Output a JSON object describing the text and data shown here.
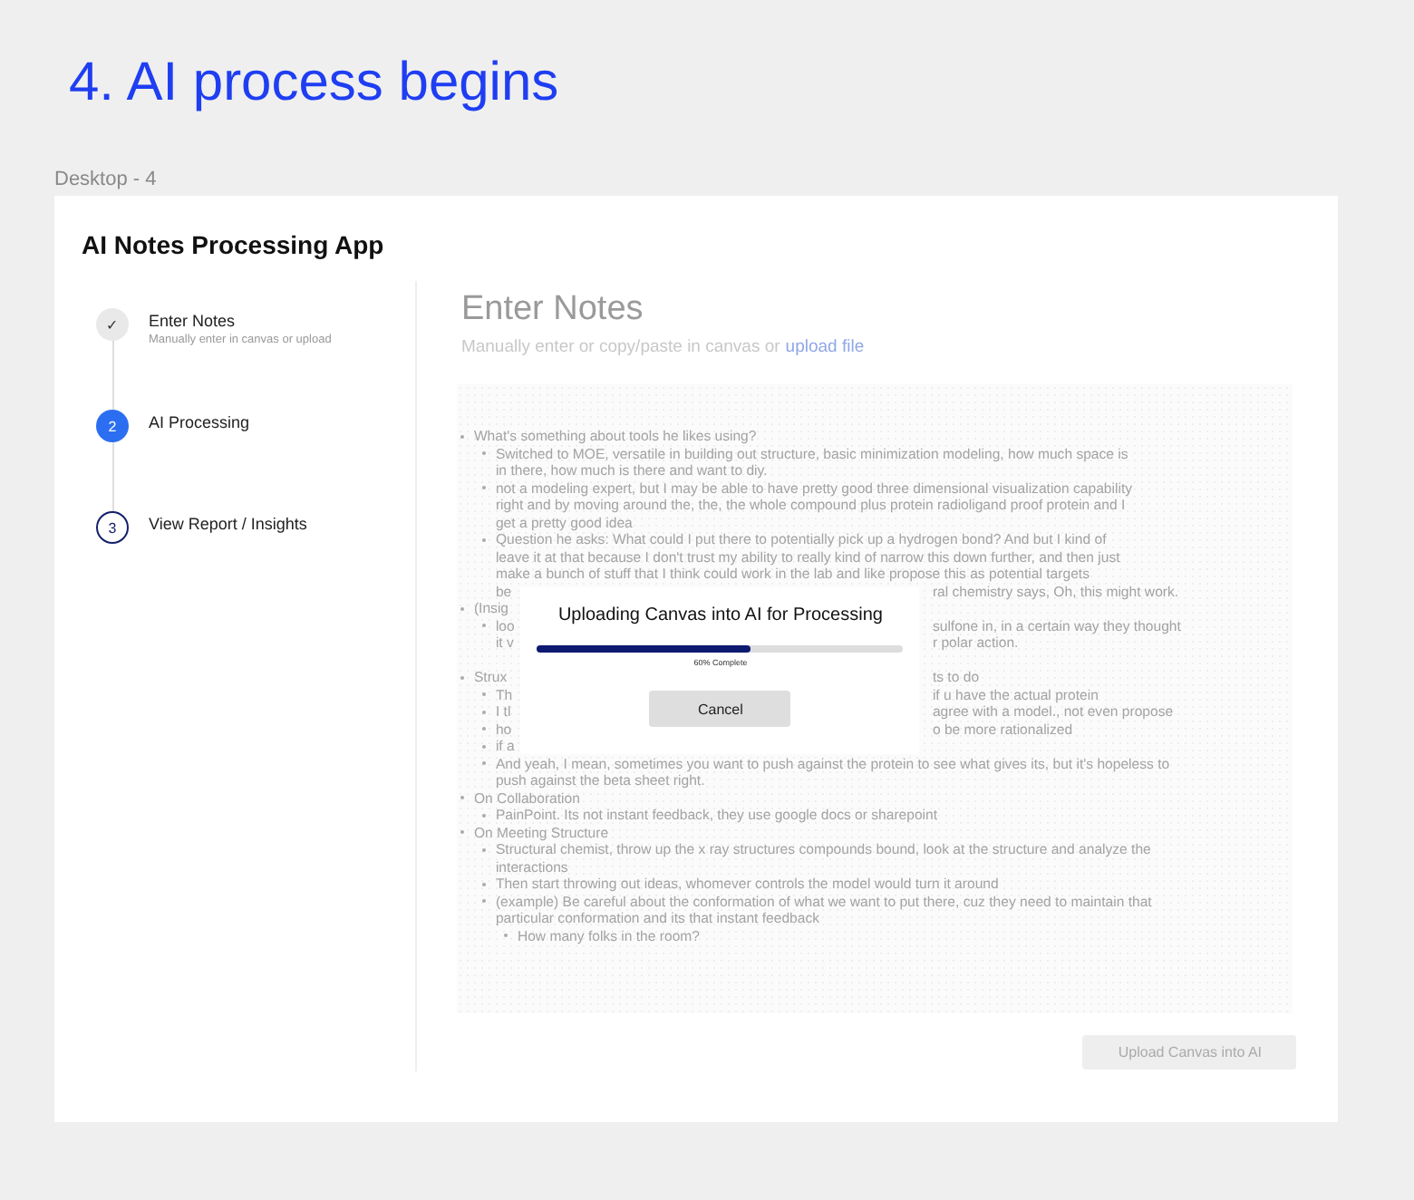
{
  "page_title": "4. AI process begins",
  "frame_label": "Desktop - 4",
  "app_title": "AI Notes Processing App",
  "steps": [
    {
      "marker": "✓",
      "label": "Enter Notes",
      "hint": "Manually enter in canvas or upload",
      "completed": true,
      "selected": false
    },
    {
      "marker": "2",
      "label": "AI Processing",
      "completed": false,
      "selected": true
    },
    {
      "marker": "3",
      "label": "View Report / Insights",
      "completed": false,
      "selected": false
    }
  ],
  "heading": "Enter Notes",
  "subtitle": "Manually enter or copy/paste in canvas or",
  "upload_link": "upload file",
  "notes": [
    {
      "lines": [
        {
          "text": "What's something about tools he likes using?"
        }
      ],
      "children": [
        {
          "lines": [
            {
              "text": "Switched to MOE, versatile in building out structure, basic minimization modeling, how much space is"
            },
            {
              "text": "in there, how much is there and want to diy."
            }
          ]
        },
        {
          "lines": [
            {
              "text": "not a modeling expert, but I may be able to have pretty good three dimensional visualization capability"
            },
            {
              "text": "right and by moving around the, the, the whole compound plus protein radioligand proof protein and I"
            },
            {
              "text": "get a pretty good idea"
            }
          ]
        },
        {
          "lines": [
            {
              "text": "Question he asks: What could I put there to potentially pick up a hydrogen bond? And but I kind of"
            },
            {
              "text": "leave it at that because I don't trust my ability to really kind of narrow this down further, and then just"
            },
            {
              "text": "make a bunch of stuff that I think could work in the lab and like propose this as potential targets"
            },
            {
              "text": "be",
              "right": "ral chemistry says, Oh, this might work."
            }
          ]
        }
      ]
    },
    {
      "lines": [
        {
          "text": "(Insig"
        }
      ],
      "children": [
        {
          "lines": [
            {
              "text": "loo",
              "right": "sulfone in, in a certain way they thought"
            },
            {
              "text": "it v",
              "right": "r polar action."
            }
          ]
        }
      ]
    },
    {
      "space_before": true,
      "lines": [
        {
          "text": "Strux",
          "right": "ts to do"
        }
      ],
      "children": [
        {
          "lines": [
            {
              "text": "Th",
              "right": "if u have the actual protein"
            }
          ]
        },
        {
          "lines": [
            {
              "text": "I tl",
              "right": "agree with a model., not even propose"
            }
          ]
        },
        {
          "lines": [
            {
              "text": "ho",
              "right": "o be more rationalized"
            }
          ]
        },
        {
          "lines": [
            {
              "text": "if a"
            }
          ]
        },
        {
          "lines": [
            {
              "text": "And yeah, I mean, sometimes you want to push against the protein to see what gives its, but it's hopeless to"
            },
            {
              "text": "push against the beta sheet right."
            }
          ]
        }
      ]
    },
    {
      "lines": [
        {
          "text": "On Collaboration"
        }
      ],
      "children": [
        {
          "lines": [
            {
              "text": "PainPoint. Its not instant feedback, they use google docs or sharepoint"
            }
          ]
        }
      ]
    },
    {
      "lines": [
        {
          "text": "On Meeting Structure"
        }
      ],
      "children": [
        {
          "lines": [
            {
              "text": "Structural chemist, throw up the x ray structures compounds bound, look at the structure and analyze the"
            },
            {
              "text": "interactions"
            }
          ]
        },
        {
          "lines": [
            {
              "text": "Then start throwing out ideas, whomever controls the model would turn it around"
            }
          ]
        },
        {
          "lines": [
            {
              "text": "(example) Be careful about the conformation of what we want to put there, cuz they need to maintain that"
            },
            {
              "text": "particular conformation and its that instant feedback"
            }
          ],
          "children": [
            {
              "lines": [
                {
                  "text": "How many folks in the room?"
                }
              ]
            }
          ]
        }
      ]
    }
  ],
  "modal": {
    "title": "Uploading Canvas into AI for Processing",
    "level": 0.58,
    "progress_text": "60% Complete",
    "cancel": "Cancel"
  },
  "upload_button": {
    "label": "Upload Canvas into AI",
    "disabled": true
  }
}
